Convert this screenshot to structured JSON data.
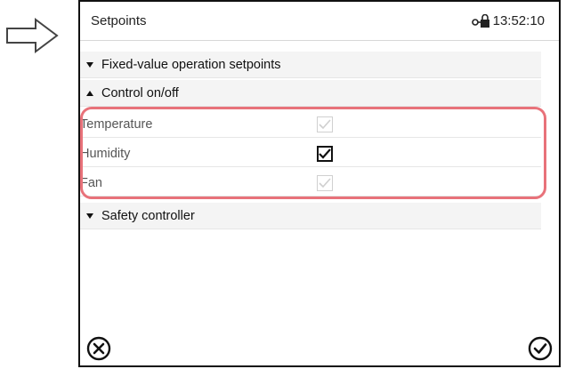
{
  "header": {
    "title": "Setpoints",
    "time": "13:52:10"
  },
  "sections": {
    "fixed_value": {
      "label": "Fixed-value operation setpoints",
      "state": "collapsed"
    },
    "control": {
      "label": "Control on/off",
      "state": "expanded"
    },
    "safety": {
      "label": "Safety controller",
      "state": "collapsed"
    }
  },
  "control_items": [
    {
      "label": "Temperature",
      "checked": true,
      "enabled": false
    },
    {
      "label": "Humidity",
      "checked": true,
      "enabled": true
    },
    {
      "label": "Fan",
      "checked": true,
      "enabled": false
    }
  ],
  "icons": {
    "pointer": "arrow-right-icon",
    "lock": "lock-icon",
    "cancel": "cancel-x-icon",
    "confirm": "confirm-check-icon"
  },
  "colors": {
    "highlight": "#e8727a",
    "section_bg": "#f4f4f4"
  }
}
